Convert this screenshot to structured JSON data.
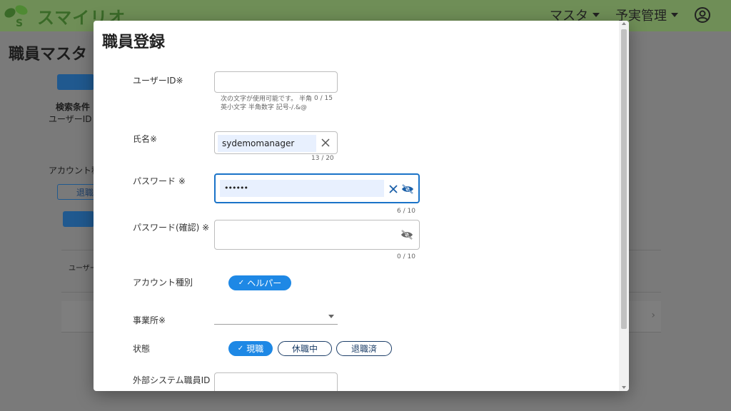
{
  "header": {
    "app_name": "スマイリオ",
    "nav": [
      {
        "label": "マスタ"
      },
      {
        "label": "予実管理"
      }
    ]
  },
  "background": {
    "page_title": "職員マスタ",
    "search_condition_label": "検索条件",
    "user_id_label": "ユーザーID",
    "account_label": "アカウント種",
    "retire_filter_label": "退職",
    "table_header_user": "ユーザー"
  },
  "dialog": {
    "title": "職員登録",
    "user_id": {
      "label": "ユーザーID※",
      "value": "",
      "hint": "次の文字が使用可能です。 半角英小文字 半角数字 記号-/.&@",
      "counter": "0 / 15"
    },
    "name": {
      "label": "氏名※",
      "value": "sydemomanager",
      "counter": "13 / 20"
    },
    "password": {
      "label": "パスワード ※",
      "value": "••••••",
      "counter": "6 / 10"
    },
    "password_confirm": {
      "label": "パスワード(確認) ※",
      "value": "",
      "counter": "0 / 10"
    },
    "account_type": {
      "label": "アカウント種別",
      "options": [
        {
          "label": "ヘルパー",
          "selected": true
        }
      ]
    },
    "office": {
      "label": "事業所※",
      "value": ""
    },
    "status": {
      "label": "状態",
      "options": [
        {
          "label": "現職",
          "selected": true
        },
        {
          "label": "休職中",
          "selected": false
        },
        {
          "label": "退職済",
          "selected": false
        }
      ]
    },
    "external_id": {
      "label": "外部システム職員ID",
      "value": ""
    }
  },
  "colors": {
    "header_bg": "#6f8e57",
    "chip_selected": "#1e88e5",
    "focus_border": "#1a73c8",
    "field_fill": "#e8f0fe"
  }
}
